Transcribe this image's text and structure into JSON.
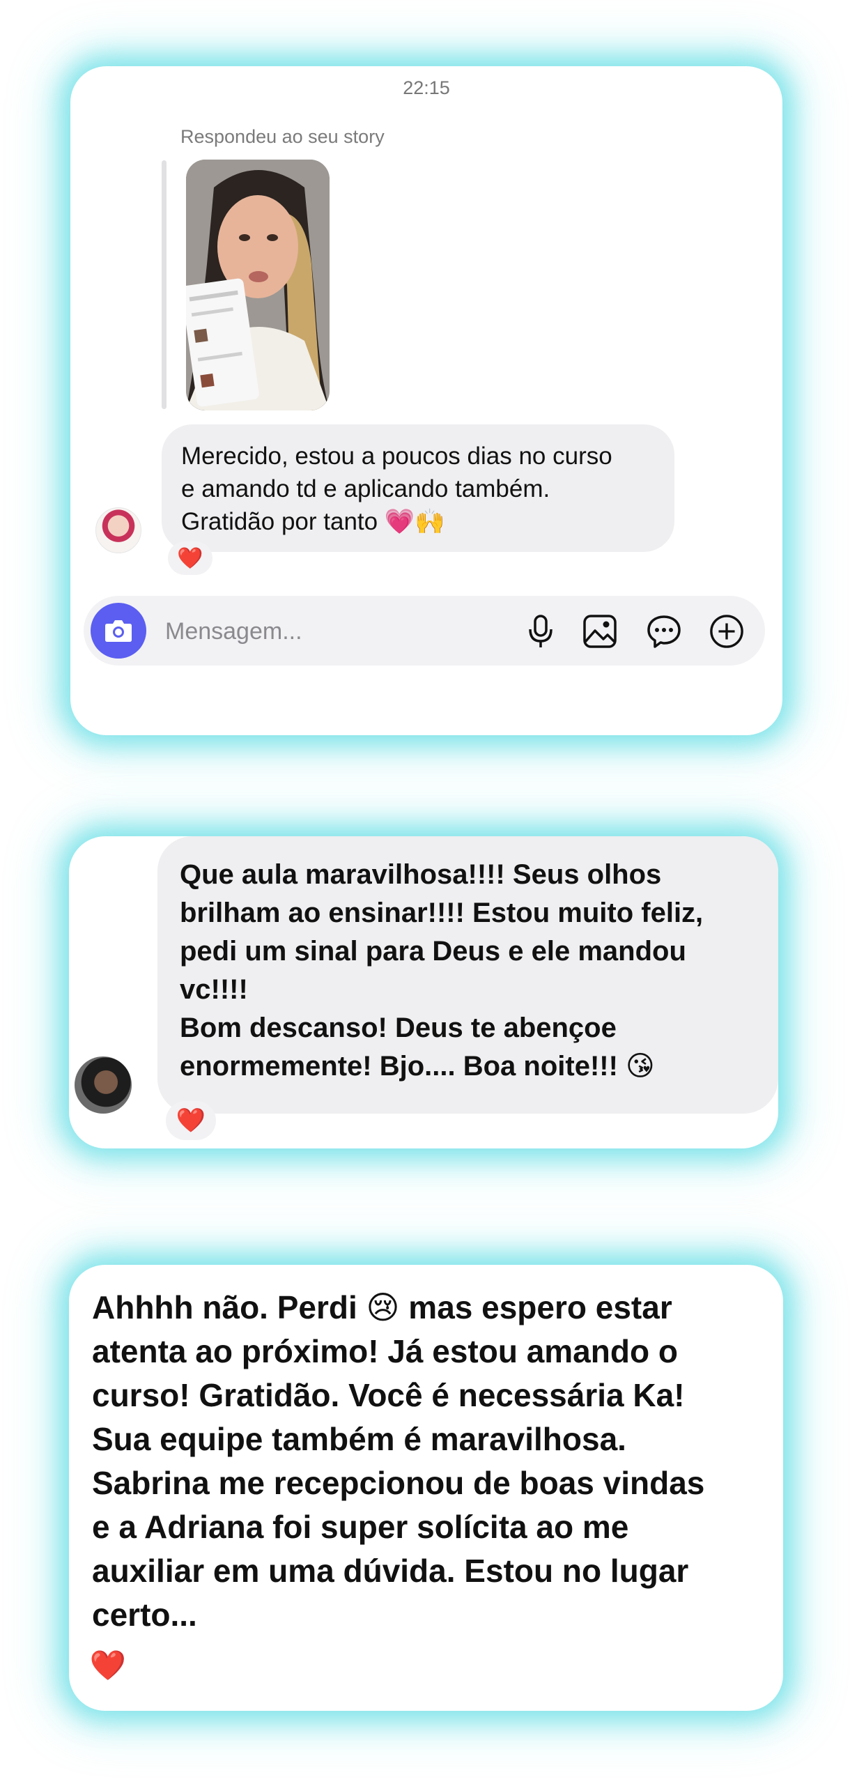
{
  "card1": {
    "time": "22:15",
    "reply_label": "Respondeu ao seu story",
    "message_lines": [
      "Merecido, estou a poucos dias no curso",
      "e amando td e aplicando também.",
      "Gratidão por tanto 💗🙌"
    ],
    "reaction": "❤️",
    "composer": {
      "placeholder": "Mensagem...",
      "icons": [
        "camera-icon",
        "microphone-icon",
        "image-icon",
        "sticker-icon",
        "plus-icon"
      ]
    }
  },
  "card2": {
    "message_lines": [
      "Que aula maravilhosa!!!!  Seus olhos",
      "brilham ao ensinar!!!! Estou muito feliz,",
      "pedi um sinal para Deus e ele mandou",
      "vc!!!!",
      "Bom descanso! Deus te abençoe",
      "enormemente! Bjo.... Boa noite!!! 😘"
    ],
    "reaction": "❤️"
  },
  "card3": {
    "message_lines": [
      "Ahhhh não. Perdi 😢 mas espero estar",
      "atenta ao próximo! Já estou amando o",
      "curso! Gratidão. Você é necessária Ka!",
      "Sua equipe também é maravilhosa.",
      "Sabrina me recepcionou de boas vindas",
      "e a Adriana foi super solícita ao me",
      "auxiliar em uma dúvida. Estou no lugar",
      "certo..."
    ],
    "reaction": "❤️"
  },
  "colors": {
    "glow": "#40d6de",
    "bubble": "#efeff1",
    "camera_button": "#5b5ef0",
    "heart": "#e0122b"
  }
}
